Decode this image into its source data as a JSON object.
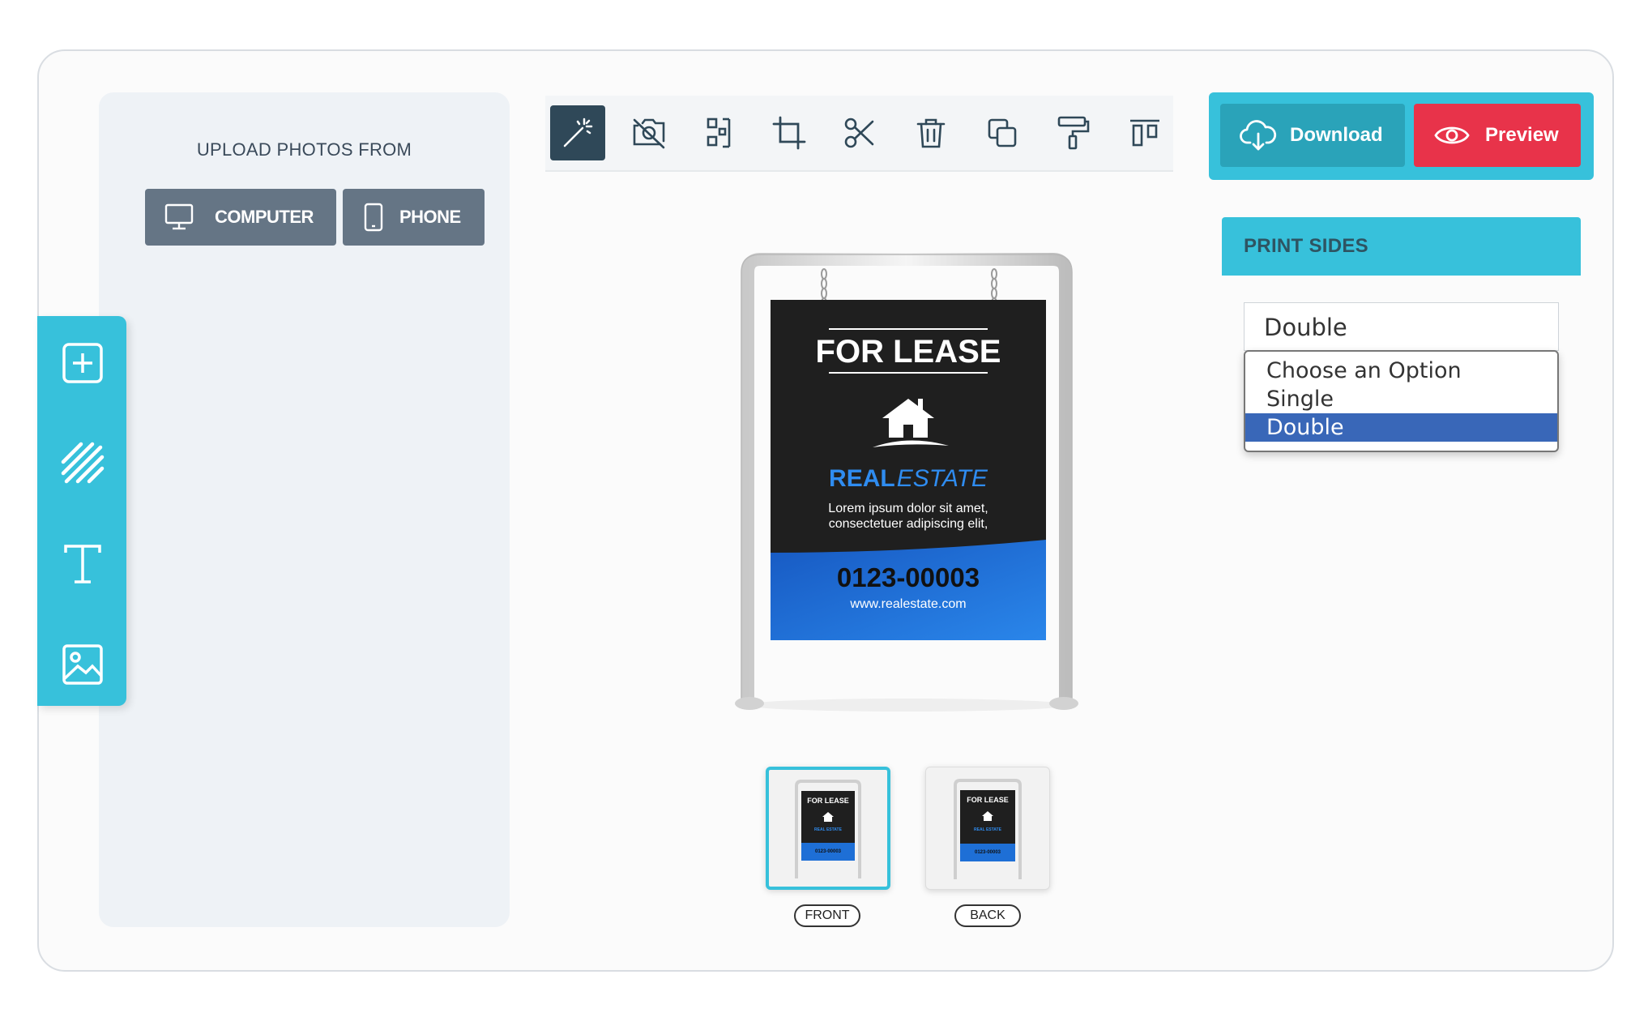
{
  "upload": {
    "title": "UPLOAD PHOTOS FROM",
    "computer_label": "COMPUTER",
    "phone_label": "PHONE"
  },
  "left_rail": {
    "items": [
      "add-icon",
      "pattern-icon",
      "text-icon",
      "image-icon"
    ]
  },
  "toolbar": {
    "tools": [
      "magic-wand-icon",
      "camera-off-icon",
      "qr-arrange-icon",
      "crop-icon",
      "scissors-icon",
      "trash-icon",
      "duplicate-icon",
      "paint-roller-icon",
      "align-top-icon"
    ],
    "active_tool": "magic-wand-icon"
  },
  "actions": {
    "download_label": "Download",
    "preview_label": "Preview"
  },
  "print_sides": {
    "title": "PRINT SIDES",
    "selected": "Double",
    "options": [
      "Choose an Option",
      "Single",
      "Double"
    ]
  },
  "sign": {
    "headline": "FOR LEASE",
    "brand_bold": "REAL",
    "brand_italic": "ESTATE",
    "body_line1": "Lorem ipsum dolor sit amet,",
    "body_line2": "consectetuer adipiscing elit,",
    "phone": "0123-00003",
    "website": "www.realestate.com"
  },
  "thumbs": {
    "front_label": "FRONT",
    "back_label": "BACK",
    "thumb_title": "FOR LEASE",
    "thumb_brand": "REAL ESTATE",
    "thumb_phone": "0123-00003"
  },
  "colors": {
    "accent": "#37c1db",
    "download": "#2aa3b9",
    "preview": "#e8334a",
    "sign_dark": "#1f1f1f",
    "sign_blue": "#1e6fd6",
    "brand_blue": "#2f8cf0"
  }
}
